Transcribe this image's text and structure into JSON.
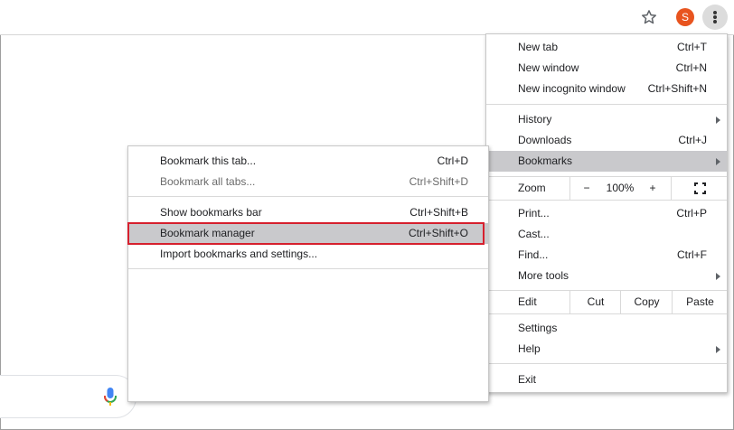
{
  "toolbar": {
    "profile_initial": "S",
    "icons": [
      "star-icon",
      "profile-avatar",
      "more-vert-icon"
    ]
  },
  "main_menu": {
    "new_tab": {
      "label": "New tab",
      "shortcut": "Ctrl+T"
    },
    "new_window": {
      "label": "New window",
      "shortcut": "Ctrl+N"
    },
    "new_incognito": {
      "label": "New incognito window",
      "shortcut": "Ctrl+Shift+N"
    },
    "history": {
      "label": "History"
    },
    "downloads": {
      "label": "Downloads",
      "shortcut": "Ctrl+J"
    },
    "bookmarks": {
      "label": "Bookmarks"
    },
    "zoom": {
      "label": "Zoom",
      "minus": "−",
      "value": "100%",
      "plus": "+"
    },
    "print": {
      "label": "Print...",
      "shortcut": "Ctrl+P"
    },
    "cast": {
      "label": "Cast..."
    },
    "find": {
      "label": "Find...",
      "shortcut": "Ctrl+F"
    },
    "more_tools": {
      "label": "More tools"
    },
    "edit": {
      "label": "Edit",
      "cut": "Cut",
      "copy": "Copy",
      "paste": "Paste"
    },
    "settings": {
      "label": "Settings"
    },
    "help": {
      "label": "Help"
    },
    "exit": {
      "label": "Exit"
    }
  },
  "bookmarks_submenu": {
    "bookmark_tab": {
      "label": "Bookmark this tab...",
      "shortcut": "Ctrl+D"
    },
    "bookmark_all": {
      "label": "Bookmark all tabs...",
      "shortcut": "Ctrl+Shift+D"
    },
    "show_bar": {
      "label": "Show bookmarks bar",
      "shortcut": "Ctrl+Shift+B"
    },
    "manager": {
      "label": "Bookmark manager",
      "shortcut": "Ctrl+Shift+O"
    },
    "import": {
      "label": "Import bookmarks and settings..."
    }
  },
  "colors": {
    "highlight": "#c9c9cc",
    "callout": "#d6202e",
    "avatar": "#e8541f"
  }
}
